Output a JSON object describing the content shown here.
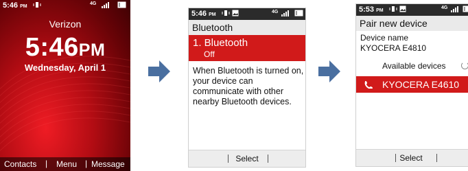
{
  "screen1": {
    "status_time": "5:46",
    "status_ampm": "PM",
    "carrier": "Verizon",
    "clock_time": "5:46",
    "clock_ampm": "PM",
    "date": "Wednesday, April 1",
    "softkeys": {
      "left": "Contacts",
      "center": "Menu",
      "right": "Message"
    }
  },
  "screen2": {
    "status_time": "5:46",
    "status_ampm": "PM",
    "title": "Bluetooth",
    "item_label": "1. Bluetooth",
    "item_value": "Off",
    "description": "When Bluetooth is turned on, your device can communicate with other nearby Bluetooth devices.",
    "softkey_center": "Select"
  },
  "screen3": {
    "status_time": "5:53",
    "status_ampm": "PM",
    "title": "Pair new device",
    "device_name_label": "Device name",
    "device_name_value": "KYOCERA E4810",
    "available_label": "Available devices",
    "found_device": "KYOCERA E4610",
    "softkey_center": "Select"
  },
  "status_network": "4G",
  "colors": {
    "accent_red": "#d11a1a",
    "arrow_blue": "#4a6fa0"
  },
  "icons": [
    "signal-icon",
    "battery-icon",
    "vibrate-icon",
    "image-icon",
    "phone-icon",
    "spinner-icon",
    "arrow-right-icon"
  ]
}
